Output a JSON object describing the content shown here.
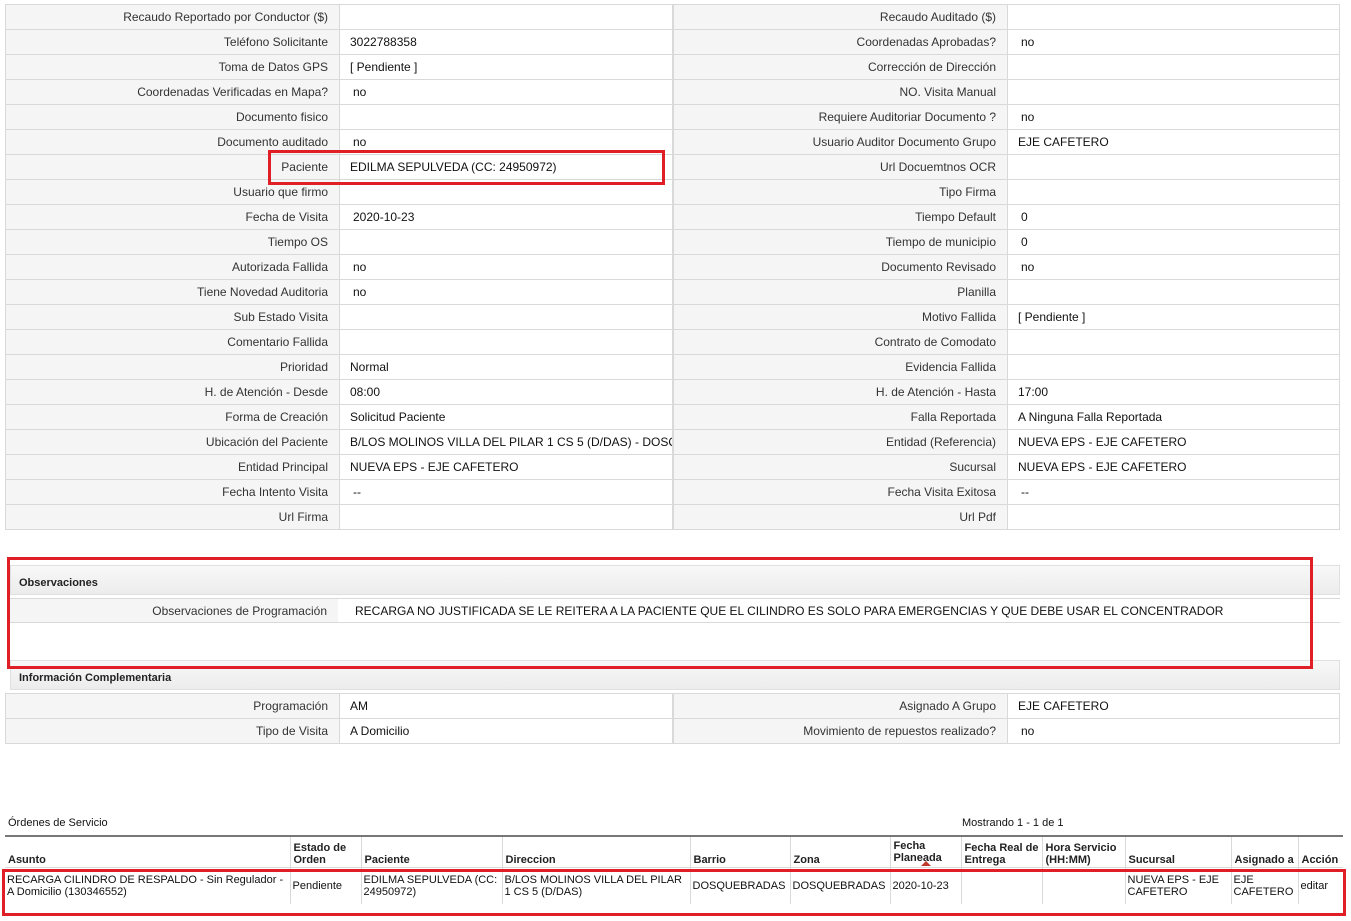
{
  "details": [
    {
      "l1": "Recaudo Reportado por Conductor ($)",
      "v1": "",
      "l2": "Recaudo Auditado ($)",
      "v2": ""
    },
    {
      "l1": "Teléfono Solicitante",
      "v1": "3022788358",
      "l2": "Coordenadas Aprobadas?",
      "v2": "no"
    },
    {
      "l1": "Toma de Datos GPS",
      "v1": "[ Pendiente ]",
      "l2": "Corrección de Dirección",
      "v2": ""
    },
    {
      "l1": "Coordenadas Verificadas en Mapa?",
      "v1": "no",
      "l2": "NO. Visita Manual",
      "v2": ""
    },
    {
      "l1": "Documento fisico",
      "v1": "",
      "l2": "Requiere Auditoriar Documento ?",
      "v2": "no"
    },
    {
      "l1": "Documento auditado",
      "v1": "no",
      "l2": "Usuario Auditor Documento Grupo",
      "v2": "EJE CAFETERO"
    },
    {
      "l1": "Paciente",
      "v1": "EDILMA SEPULVEDA (CC: 24950972)",
      "l2": "Url Docuemtnos OCR",
      "v2": ""
    },
    {
      "l1": "Usuario que firmo",
      "v1": "",
      "l2": "Tipo Firma",
      "v2": ""
    },
    {
      "l1": "Fecha de Visita",
      "v1": "2020-10-23",
      "l2": "Tiempo Default",
      "v2": "0"
    },
    {
      "l1": "Tiempo OS",
      "v1": "",
      "l2": "Tiempo de municipio",
      "v2": "0"
    },
    {
      "l1": "Autorizada Fallida",
      "v1": "no",
      "l2": "Documento Revisado",
      "v2": "no"
    },
    {
      "l1": "Tiene Novedad Auditoria",
      "v1": "no",
      "l2": "Planilla",
      "v2": ""
    },
    {
      "l1": "Sub Estado Visita",
      "v1": "",
      "l2": "Motivo Fallida",
      "v2": "[ Pendiente ]"
    },
    {
      "l1": "Comentario Fallida",
      "v1": "",
      "l2": "Contrato de Comodato",
      "v2": ""
    },
    {
      "l1": "Prioridad",
      "v1": "Normal",
      "l2": "Evidencia Fallida",
      "v2": ""
    },
    {
      "l1": "H. de Atención - Desde",
      "v1": "08:00",
      "l2": "H. de Atención - Hasta",
      "v2": "17:00"
    },
    {
      "l1": "Forma de Creación",
      "v1": "Solicitud Paciente",
      "l2": "Falla Reportada",
      "v2": "A Ninguna Falla Reportada"
    },
    {
      "l1": "Ubicación del Paciente",
      "v1": "B/LOS MOLINOS VILLA DEL PILAR 1 CS 5 (D/DAS) - DOSQ",
      "l2": "Entidad (Referencia)",
      "v2": "NUEVA EPS - EJE CAFETERO"
    },
    {
      "l1": "Entidad Principal",
      "v1": "NUEVA EPS - EJE CAFETERO",
      "l2": "Sucursal",
      "v2": "NUEVA EPS - EJE CAFETERO"
    },
    {
      "l1": "Fecha Intento Visita",
      "v1": "--",
      "l2": "Fecha Visita Exitosa",
      "v2": "--"
    },
    {
      "l1": "Url Firma",
      "v1": "",
      "l2": "Url Pdf",
      "v2": ""
    }
  ],
  "observaciones": {
    "title": "Observaciones",
    "label": "Observaciones de Programación",
    "value": "RECARGA NO JUSTIFICADA SE LE REITERA A LA PACIENTE QUE EL CILINDRO ES SOLO PARA EMERGENCIAS Y QUE DEBE USAR EL CONCENTRADOR"
  },
  "complementaria": {
    "title": "Información Complementaria",
    "rows": [
      {
        "l1": "Programación",
        "v1": "AM",
        "l2": "Asignado A Grupo",
        "v2": "EJE CAFETERO"
      },
      {
        "l1": "Tipo de Visita",
        "v1": "A Domicilio",
        "l2": "Movimiento de repuestos realizado?",
        "v2": "no"
      }
    ]
  },
  "orders": {
    "caption": "Órdenes de Servicio",
    "count": "Mostrando 1 - 1 de 1",
    "headers": [
      "Asunto",
      "Estado de Orden",
      "Paciente",
      "Direccion",
      "Barrio",
      "Zona",
      "Fecha Planeada",
      "Fecha Real de Entrega",
      "Hora Servicio (HH:MM)",
      "Sucursal",
      "Asignado a",
      "Acción"
    ],
    "rows": [
      [
        "RECARGA CILINDRO DE RESPALDO - Sin Regulador - A Domicilio (130346552)",
        "Pendiente",
        "EDILMA SEPULVEDA (CC: 24950972)",
        "B/LOS MOLINOS VILLA DEL PILAR 1 CS 5 (D/DAS)",
        "DOSQUEBRADAS",
        "DOSQUEBRADAS",
        "2020-10-23",
        "",
        "",
        "NUEVA EPS - EJE CAFETERO",
        "EJE CAFETERO",
        "editar"
      ]
    ]
  },
  "colors": {
    "highlight": "#e01e26",
    "sort_arrow": "#c0392b"
  }
}
